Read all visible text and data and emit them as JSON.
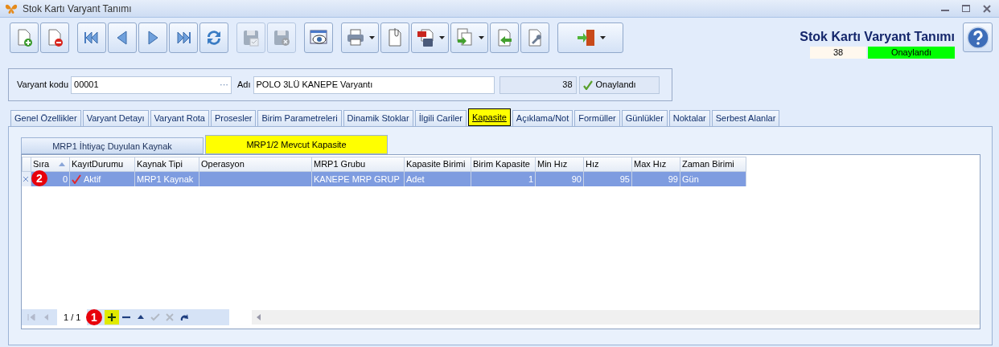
{
  "window": {
    "title": "Stok Kartı Varyant Tanımı"
  },
  "toolbar": [
    {
      "disabled": false,
      "dropdown": false
    },
    {
      "disabled": false,
      "dropdown": false
    },
    {
      "disabled": false,
      "dropdown": false
    },
    {
      "disabled": false,
      "dropdown": false
    },
    {
      "disabled": false,
      "dropdown": false
    },
    {
      "disabled": false,
      "dropdown": false
    },
    {
      "disabled": false,
      "dropdown": false
    },
    {
      "disabled": true,
      "dropdown": false
    },
    {
      "disabled": true,
      "dropdown": false
    },
    {
      "disabled": false,
      "dropdown": false
    },
    {
      "disabled": false,
      "dropdown": true
    },
    {
      "disabled": false,
      "dropdown": false
    },
    {
      "disabled": false,
      "dropdown": true
    },
    {
      "disabled": false,
      "dropdown": true
    },
    {
      "disabled": false,
      "dropdown": false
    },
    {
      "disabled": false,
      "dropdown": false
    },
    {
      "disabled": false,
      "dropdown": true
    }
  ],
  "header": {
    "title": "Stok Kartı Varyant Tanımı",
    "number": "38",
    "status": "Onaylandı"
  },
  "form": {
    "code_label": "Varyant kodu",
    "code": "00001",
    "ellipsis": "···",
    "name_label": "Adı",
    "name": "POLO 3LÜ KANEPE Varyantı",
    "number": "38",
    "status": "Onaylandı"
  },
  "tabs": [
    {
      "label": "Genel Özellikler",
      "selected": false
    },
    {
      "label": "Varyant Detayı",
      "selected": false
    },
    {
      "label": "Varyant Rota",
      "selected": false
    },
    {
      "label": "Prosesler",
      "selected": false
    },
    {
      "label": "Birim Parametreleri",
      "selected": false
    },
    {
      "label": "Dinamik Stoklar",
      "selected": false
    },
    {
      "label": "İlgili Cariler",
      "selected": false
    },
    {
      "label": "Kapasite",
      "selected": true
    },
    {
      "label": "Açıklama/Not",
      "selected": false
    },
    {
      "label": "Formüller",
      "selected": false
    },
    {
      "label": "Günlükler",
      "selected": false
    },
    {
      "label": "Noktalar",
      "selected": false
    },
    {
      "label": "Serbest Alanlar",
      "selected": false
    }
  ],
  "subtabs": [
    {
      "label": "MRP1 İhtiyaç Duyulan Kaynak",
      "selected": false
    },
    {
      "label": "MRP1/2 Mevcut Kapasite",
      "selected": true
    }
  ],
  "grid": {
    "columns": [
      {
        "label": "Sıra",
        "numeric": true,
        "sorted": true
      },
      {
        "label": "KayıtDurumu",
        "numeric": false,
        "sorted": false
      },
      {
        "label": "Kaynak Tipi",
        "numeric": false,
        "sorted": false
      },
      {
        "label": "Operasyon",
        "sorted": false
      },
      {
        "label": "MRP1 Grubu",
        "numeric": false,
        "sorted": false
      },
      {
        "label": "Kapasite Birimi",
        "numeric": false,
        "sorted": false
      },
      {
        "label": "Birim Kapasite",
        "numeric": true,
        "sorted": false
      },
      {
        "label": "Min Hız",
        "numeric": true,
        "sorted": false
      },
      {
        "label": "Hız",
        "numeric": true,
        "sorted": false
      },
      {
        "label": "Max Hız",
        "numeric": true,
        "sorted": false
      },
      {
        "label": "Zaman Birimi",
        "numeric": false,
        "sorted": false
      }
    ],
    "rows": [
      {
        "selected": true,
        "active": true,
        "cells": [
          "0",
          "Aktif",
          "MRP1 Kaynak",
          null,
          "KANEPE MRP GRUP",
          "Adet",
          "1",
          "90",
          "95",
          "99",
          "Gün"
        ]
      }
    ]
  },
  "navigator": {
    "page": "1 / 1",
    "buttons": [
      {
        "highlighted": false,
        "disabled": true
      },
      {
        "highlighted": false,
        "disabled": true
      },
      {
        "highlighted": true,
        "disabled": false
      },
      {
        "highlighted": false,
        "disabled": false
      },
      {
        "highlighted": false,
        "disabled": false
      },
      {
        "highlighted": false,
        "disabled": true
      },
      {
        "highlighted": false,
        "disabled": true
      },
      {
        "highlighted": false,
        "disabled": false
      }
    ]
  },
  "callouts": [
    {
      "label": "2"
    },
    {
      "label": "1"
    }
  ]
}
